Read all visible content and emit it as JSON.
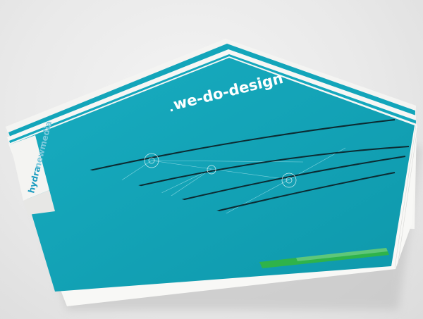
{
  "photo": {
    "subject": "brochure stack",
    "colors": {
      "background": "#ebebeb",
      "page_white": "#f7f7f5",
      "cover_teal": "#14a8bd",
      "cover_teal_dark": "#0f94a8",
      "spine_shadow": "#c9c9c9",
      "wire": "#0c2b32",
      "text_white": "#ffffff",
      "accent_green": "#2fb34a",
      "logo_blue": "#1b9cc0"
    },
    "cover": {
      "tagline": "we-do-design",
      "logo_word_1": "hydra",
      "logo_word_2": "newmedia",
      "wire_labels": [
        "",
        "",
        ""
      ]
    }
  }
}
